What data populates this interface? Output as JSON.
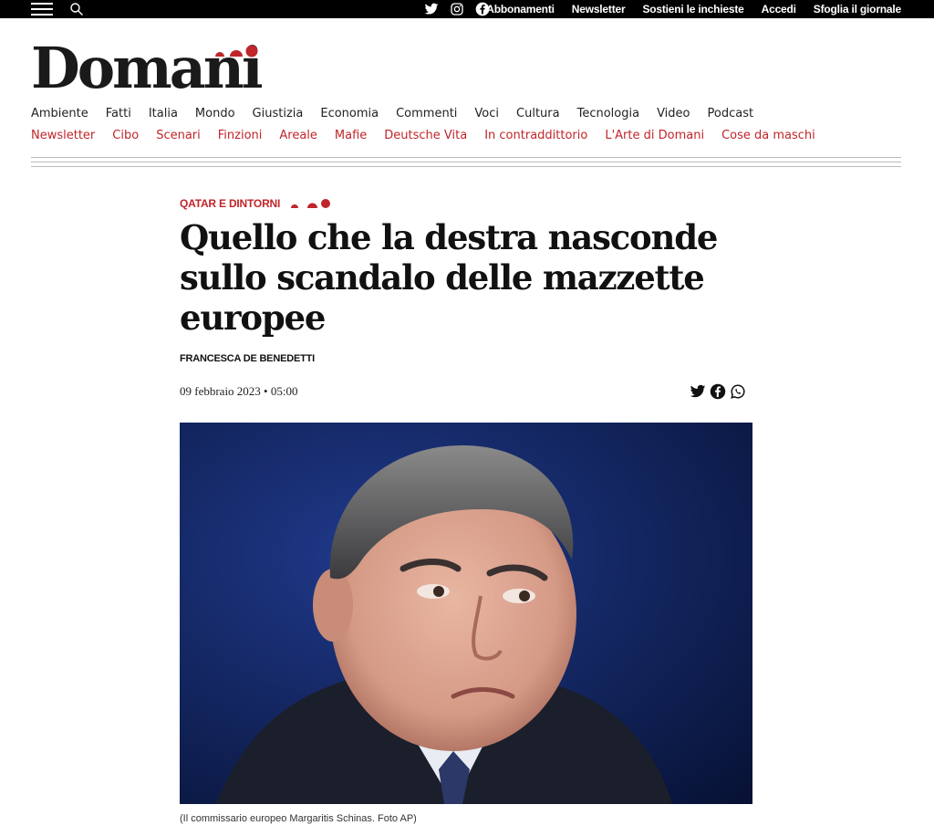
{
  "topbar": {
    "menu_icon": "hamburger-icon",
    "search_icon": "search-icon",
    "social": [
      "twitter-icon",
      "instagram-icon",
      "facebook-icon"
    ],
    "links": [
      "Abbonamenti",
      "Newsletter",
      "Sostieni le inchieste",
      "Accedi",
      "Sfoglia il giornale"
    ]
  },
  "brand": {
    "logo_text": "Domani",
    "accent_color": "#c0252a"
  },
  "nav": {
    "primary": [
      "Ambiente",
      "Fatti",
      "Italia",
      "Mondo",
      "Giustizia",
      "Economia",
      "Commenti",
      "Voci",
      "Cultura",
      "Tecnologia",
      "Video",
      "Podcast"
    ],
    "secondary": [
      "Newsletter",
      "Cibo",
      "Scenari",
      "Finzioni",
      "Areale",
      "Mafie",
      "Deutsche Vita",
      "In contraddittorio",
      "L'Arte di Domani",
      "Cose da maschi"
    ]
  },
  "article": {
    "kicker": "QATAR E DINTORNI",
    "headline": "Quello che la destra nasconde sullo scandalo delle mazzette europee",
    "author": "FRANCESCA DE BENEDETTI",
    "date": "09 febbraio 2023 • 05:00",
    "share_icons": [
      "twitter-icon",
      "facebook-icon",
      "whatsapp-icon"
    ],
    "image_caption": "(Il commissario europeo Margaritis Schinas. Foto AP)"
  }
}
